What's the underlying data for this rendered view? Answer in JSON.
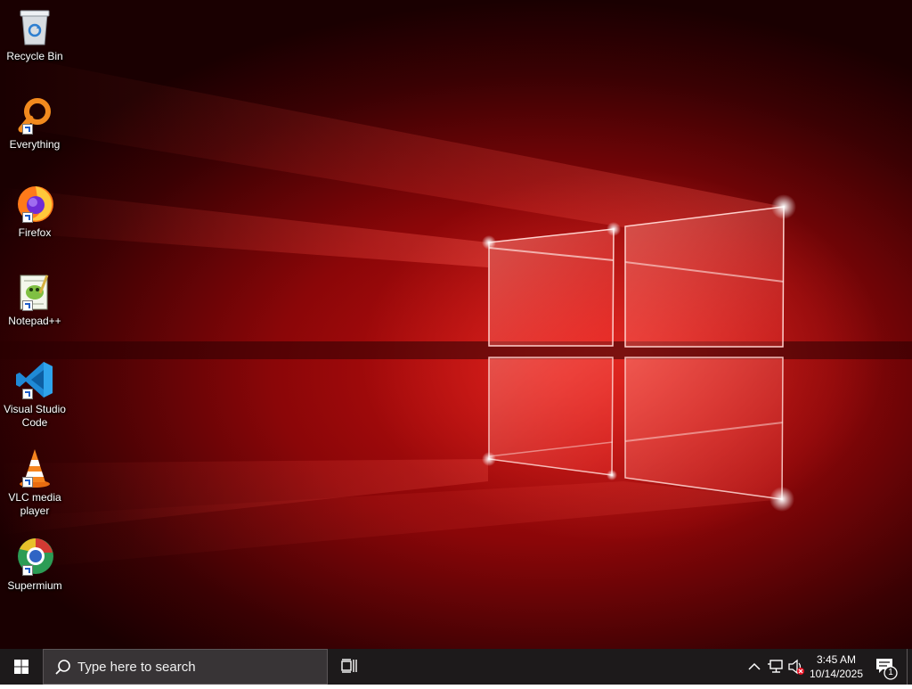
{
  "desktop": {
    "icons": [
      {
        "label": "Recycle Bin",
        "icon": "recycle-bin-icon",
        "shortcut": false
      },
      {
        "label": "Everything",
        "icon": "everything-icon",
        "shortcut": true
      },
      {
        "label": "Firefox",
        "icon": "firefox-icon",
        "shortcut": true
      },
      {
        "label": "Notepad++",
        "icon": "notepad-plus-plus-icon",
        "shortcut": true
      },
      {
        "label": "Visual Studio Code",
        "icon": "vscode-icon",
        "shortcut": true
      },
      {
        "label": "VLC media player",
        "icon": "vlc-icon",
        "shortcut": true
      },
      {
        "label": "Supermium",
        "icon": "supermium-icon",
        "shortcut": true
      }
    ]
  },
  "taskbar": {
    "search": {
      "placeholder": "Type here to search"
    },
    "clock": {
      "time": "3:45 AM",
      "date": "10/14/2025"
    },
    "notifications": {
      "count": "1"
    }
  },
  "colors": {
    "taskbar": "#1d1a1b",
    "search_box": "#383436",
    "wallpaper_accent": "#c8100f"
  }
}
